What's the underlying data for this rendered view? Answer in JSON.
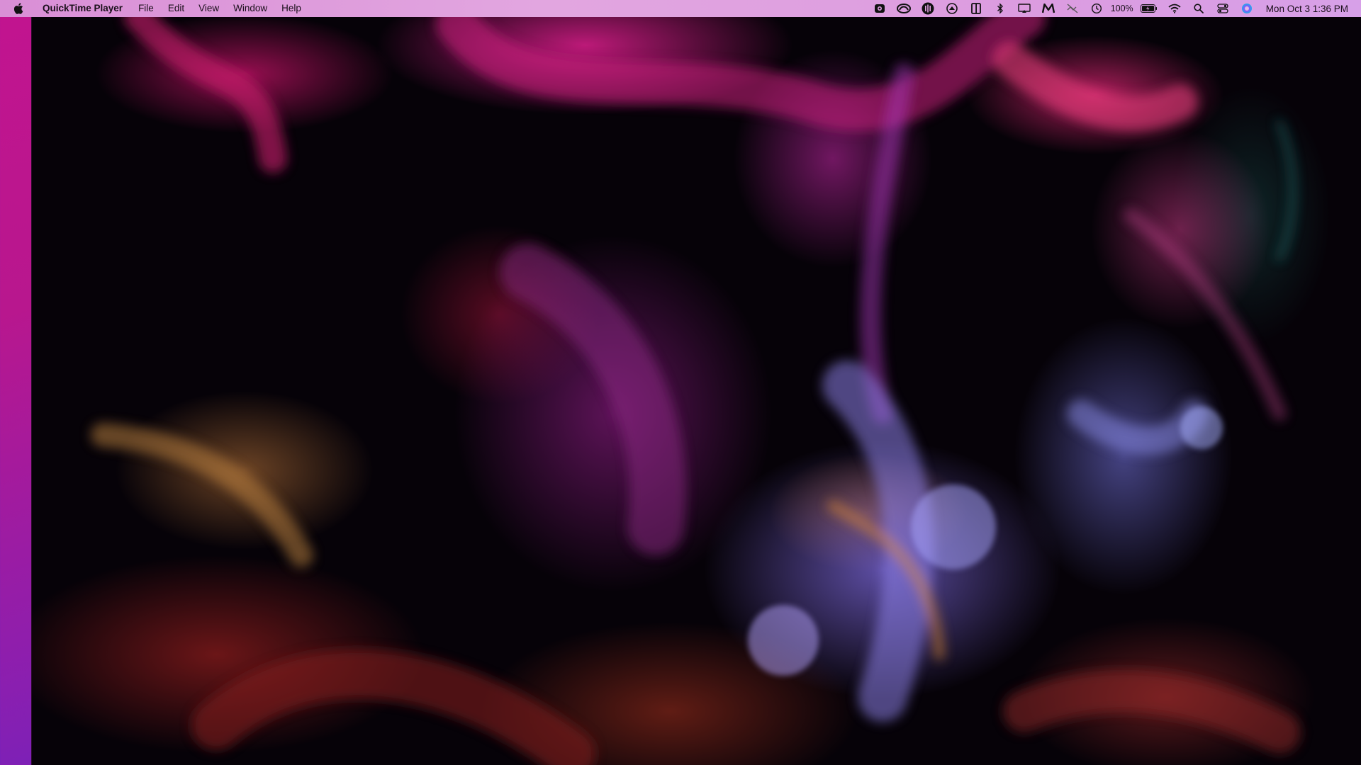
{
  "menubar": {
    "app_name": "QuickTime Player",
    "items": [
      "File",
      "Edit",
      "View",
      "Window",
      "Help"
    ],
    "battery_percent": "100%",
    "clock": "Mon Oct 3  1:36 PM",
    "status_icons": [
      "screen-record-icon",
      "creative-cloud-icon",
      "audio-app-icon",
      "caret-app-icon",
      "reader-icon",
      "bluetooth-icon",
      "display-mirror-icon",
      "m-app-icon",
      "mute-icon",
      "time-machine-icon",
      "battery-icon",
      "wifi-icon",
      "spotlight-search-icon",
      "control-center-icon",
      "siri-icon"
    ]
  },
  "colors": {
    "menubar_bg": "#dea2de",
    "desktop_magenta": "#c2148f",
    "desktop_violet": "#5a24c8",
    "video_bg": "#070208"
  }
}
